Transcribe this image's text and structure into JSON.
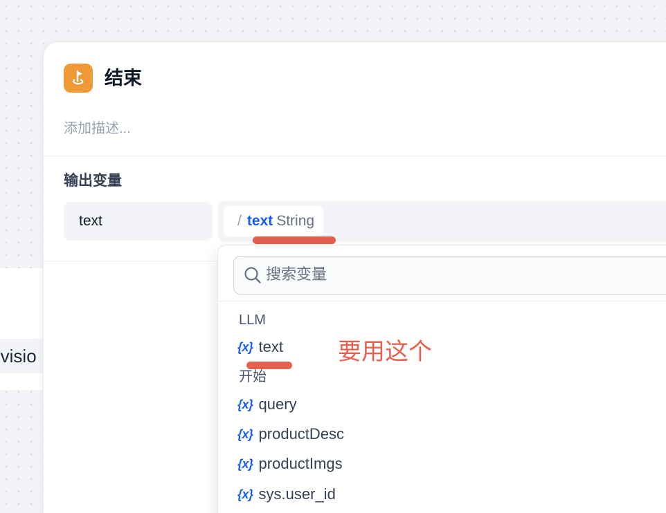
{
  "background_node": {
    "text": "-visio"
  },
  "end_node": {
    "title": "结束",
    "description": "添加描述...",
    "icon": "flag-icon",
    "accent_color": "#f09a37"
  },
  "outputs": {
    "section_label": "输出变量",
    "variable_name": "text",
    "selected": {
      "separator": "/",
      "var": "text",
      "type": "String"
    }
  },
  "dropdown": {
    "search_placeholder": "搜索变量",
    "groups": [
      {
        "label": "LLM",
        "items": [
          {
            "icon": "{x}",
            "name": "text"
          }
        ]
      },
      {
        "label": "开始",
        "items": [
          {
            "icon": "{x}",
            "name": "query"
          },
          {
            "icon": "{x}",
            "name": "productDesc"
          },
          {
            "icon": "{x}",
            "name": "productImgs"
          },
          {
            "icon": "{x}",
            "name": "sys.user_id"
          }
        ]
      }
    ]
  },
  "annotation": {
    "text": "要用这个",
    "color": "#e4604f"
  }
}
